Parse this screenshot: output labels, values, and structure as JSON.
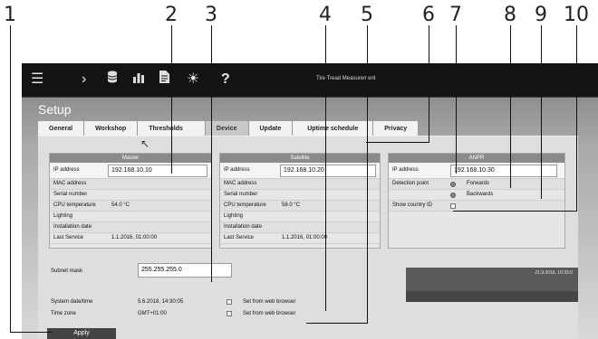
{
  "callouts": [
    "1",
    "2",
    "3",
    "4",
    "5",
    "6",
    "7",
    "8",
    "9",
    "10"
  ],
  "toolbar": {
    "icons": [
      "menu-icon",
      "chevron-right-icon",
      "database-icon",
      "bar-chart-icon",
      "document-icon",
      "sun-icon",
      "help-icon"
    ],
    "title": "Tire Tread Measurement"
  },
  "page": {
    "title": "Setup"
  },
  "tabs": [
    {
      "label": "General"
    },
    {
      "label": "Workshop"
    },
    {
      "label": "Thresholds"
    },
    {
      "label": "Device",
      "active": true
    },
    {
      "label": "Update"
    },
    {
      "label": "Uptime schedule"
    },
    {
      "label": "Privacy"
    }
  ],
  "master": {
    "title": "Master",
    "ip_label": "IP address",
    "ip_value": "192.168.10.10",
    "mac_label": "MAC address",
    "serial_label": "Serial number",
    "cpu_label": "CPU temperature",
    "cpu_value": "54.0 °C",
    "lighting_label": "Lighting",
    "install_label": "Installation date",
    "service_label": "Last Service",
    "service_value": "1.1.2016, 01:00:00"
  },
  "satellite": {
    "title": "Satellite",
    "ip_label": "IP address",
    "ip_value": "192.168.10.20",
    "mac_label": "MAC address",
    "serial_label": "Serial number",
    "cpu_label": "CPU temperature",
    "cpu_value": "58.0 °C",
    "lighting_label": "Lighting",
    "install_label": "Installation date",
    "service_label": "Last Service",
    "service_value": "1.1.2016, 01:00:00"
  },
  "anpr": {
    "title": "ANPR",
    "ip_label": "IP address",
    "ip_value": "192.168.10.30",
    "detection_label": "Detection point",
    "forwards_label": "Forwards",
    "backwards_label": "Backwards",
    "country_label": "Show country ID"
  },
  "network": {
    "subnet_label": "Subnet mask",
    "subnet_value": "255.255.255.0",
    "datetime_label": "System date/time",
    "datetime_value": "5.6.2018, 14:30:05",
    "timezone_label": "Time zone",
    "timezone_value": "GMT+01:00",
    "set_browser_label": "Set from web browser",
    "set_browser_label_2": "Set from web browser"
  },
  "preview": {
    "timestamp": "21.9.2016, 10:33:0"
  },
  "apply_label": "Apply",
  "colors": {
    "topbar": "#141414",
    "panel_header": "#8a8a8a",
    "apply_button": "#444444"
  }
}
